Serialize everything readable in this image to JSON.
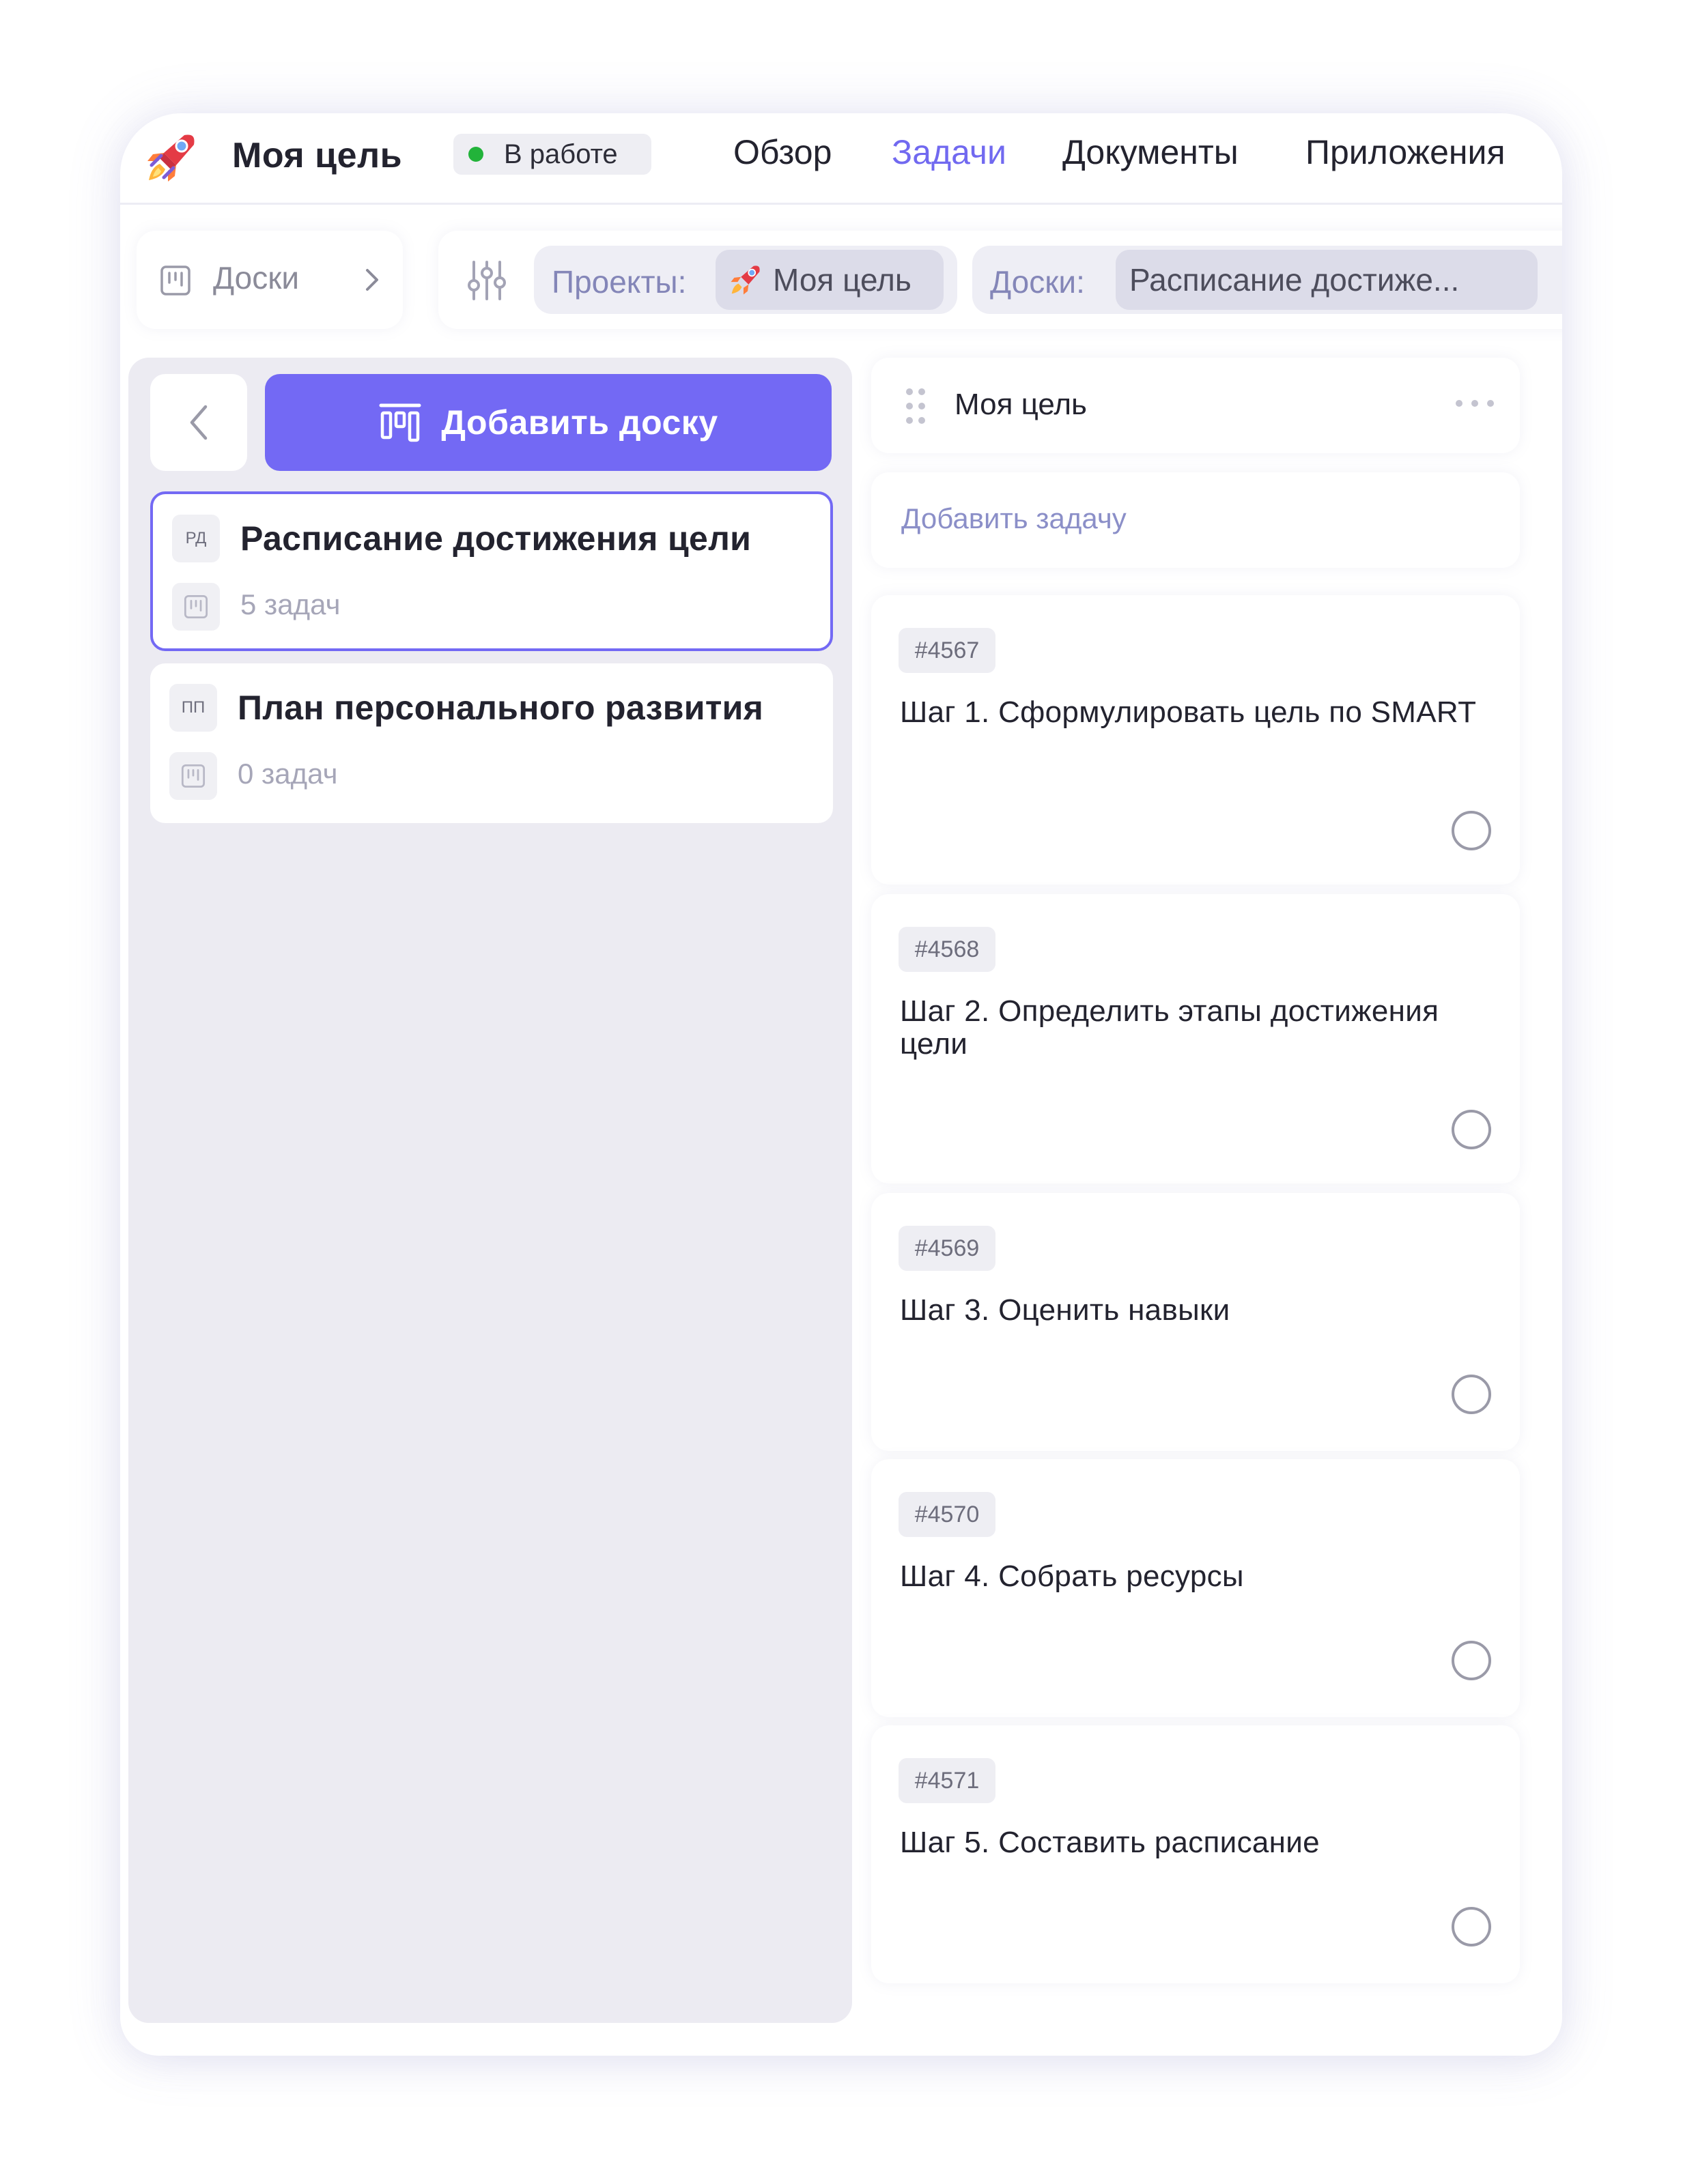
{
  "header": {
    "title": "Моя цель",
    "status": "В работе",
    "status_color": "#22b33a",
    "nav": [
      {
        "label": "Обзор",
        "active": false
      },
      {
        "label": "Задачи",
        "active": true
      },
      {
        "label": "Документы",
        "active": false
      },
      {
        "label": "Приложения",
        "active": false
      }
    ]
  },
  "breadcrumb": {
    "label": "Доски"
  },
  "filters": {
    "projects_label": "Проекты:",
    "projects_value": "Моя цель",
    "boards_label": "Доски:",
    "boards_value": "Расписание достиже..."
  },
  "sidebar": {
    "add_board_label": "Добавить доску",
    "boards": [
      {
        "abbr": "РД",
        "name": "Расписание достижения цели",
        "count": "5 задач",
        "selected": true
      },
      {
        "abbr": "ПП",
        "name": "План персонального развития",
        "count": "0 задач",
        "selected": false
      }
    ]
  },
  "column": {
    "title": "Моя цель",
    "add_task_placeholder": "Добавить задачу",
    "tasks": [
      {
        "id": "#4567",
        "title": "Шаг 1. Сформулировать цель по SMART"
      },
      {
        "id": "#4568",
        "title": "Шаг 2. Определить этапы достижения цели"
      },
      {
        "id": "#4569",
        "title": "Шаг 3. Оценить навыки"
      },
      {
        "id": "#4570",
        "title": "Шаг 4. Собрать ресурсы"
      },
      {
        "id": "#4571",
        "title": "Шаг 5. Составить расписание"
      }
    ]
  },
  "colors": {
    "accent": "#7369f4",
    "panel_bg": "#ecebf2"
  },
  "icons": [
    "rocket-icon",
    "board-icon",
    "chevron-right-icon",
    "filter-icon",
    "chevron-left-icon",
    "add-board-icon",
    "drag-handle-icon",
    "more-icon",
    "checkbox-circle-icon"
  ]
}
